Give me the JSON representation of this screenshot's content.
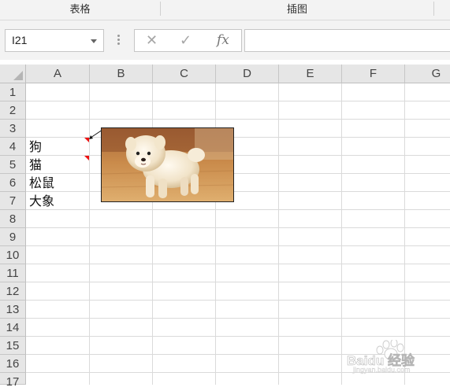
{
  "ribbon": {
    "groups": [
      {
        "label": "表格"
      },
      {
        "label": "插图"
      }
    ]
  },
  "formula_bar": {
    "name_box": "I21",
    "cancel_icon": "✕",
    "enter_icon": "✓",
    "fx_label": "fx",
    "formula": ""
  },
  "sheet": {
    "columns": [
      "A",
      "B",
      "C",
      "D",
      "E",
      "F",
      "G"
    ],
    "rows": [
      "1",
      "2",
      "3",
      "4",
      "5",
      "6",
      "7",
      "8",
      "9",
      "10",
      "11",
      "12",
      "13",
      "14",
      "15",
      "16",
      "17"
    ],
    "cells": {
      "A4": "狗",
      "A5": "猫",
      "A6": "松鼠",
      "A7": "大象"
    },
    "comment_indicators": [
      "A4",
      "A5"
    ],
    "picture": {
      "subject": "white puppy photo",
      "anchor": "B3"
    }
  },
  "watermark": {
    "text": "Baidu 经验",
    "subtext": "jingyan.baidu.com"
  },
  "colors": {
    "header_bg": "#e6e6e6",
    "gridline": "#dadada",
    "comment_indicator": "#ee1111",
    "ribbon_bg": "#f3f3f3"
  }
}
